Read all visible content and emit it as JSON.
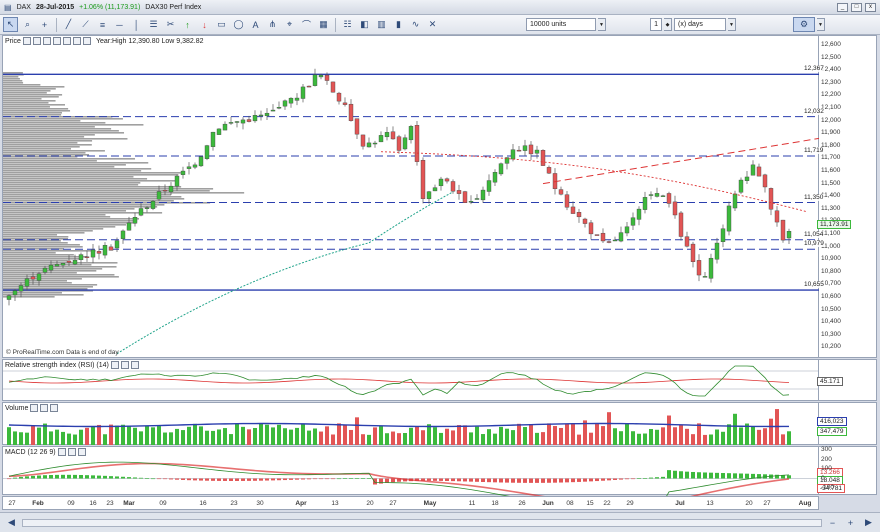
{
  "titlebar": {
    "instrument": "DAX",
    "date": "28-Jul-2015",
    "change": "+1.06% (11,173.91)",
    "compare": "DAX30 Perf Index"
  },
  "toolbar": {
    "units": "10000 units",
    "period_value": "1",
    "period_unit": "(x) days"
  },
  "price_panel": {
    "label": "Price",
    "info": "Year:High 12,390.80 Low 9,382.82",
    "watermark": "© ProRealTime.com   Data is end of day",
    "current_price": "11,173.91",
    "y_ticks": [
      "12,600",
      "12,500",
      "12,400",
      "12,300",
      "12,200",
      "12,100",
      "12,000",
      "11,900",
      "11,800",
      "11,700",
      "11,600",
      "11,500",
      "11,400",
      "11,300",
      "11,200",
      "11,100",
      "11,000",
      "10,900",
      "10,800",
      "10,700",
      "10,600",
      "10,500",
      "10,400",
      "10,300",
      "10,200"
    ],
    "levels": [
      "12,367",
      "12,032",
      "11,719",
      "11,350",
      "11,054",
      "10,979",
      "10,655"
    ]
  },
  "rsi_panel": {
    "label": "Relative strength index (RSI) (14)",
    "value": "45.171"
  },
  "volume_panel": {
    "label": "Volume",
    "value1": "416,023",
    "value2": "347,479"
  },
  "macd_panel": {
    "label": "MACD (12 26 9)",
    "ticks": [
      "300",
      "200",
      "100",
      "0",
      "-100"
    ],
    "value1": "13.266",
    "value2": "18.048",
    "value3": "-34.781"
  },
  "x_axis": [
    "27",
    "Feb",
    "09",
    "16",
    "23",
    "Mar",
    "09",
    "16",
    "23",
    "30",
    "Apr",
    "13",
    "20",
    "27",
    "May",
    "11",
    "18",
    "26",
    "Jun",
    "08",
    "15",
    "22",
    "29",
    "Jul",
    "13",
    "20",
    "27",
    "Aug"
  ],
  "colors": {
    "up": "#3cb93c",
    "down": "#e25555",
    "levels": "#2b3fae",
    "ma": "#1fa38a"
  }
}
